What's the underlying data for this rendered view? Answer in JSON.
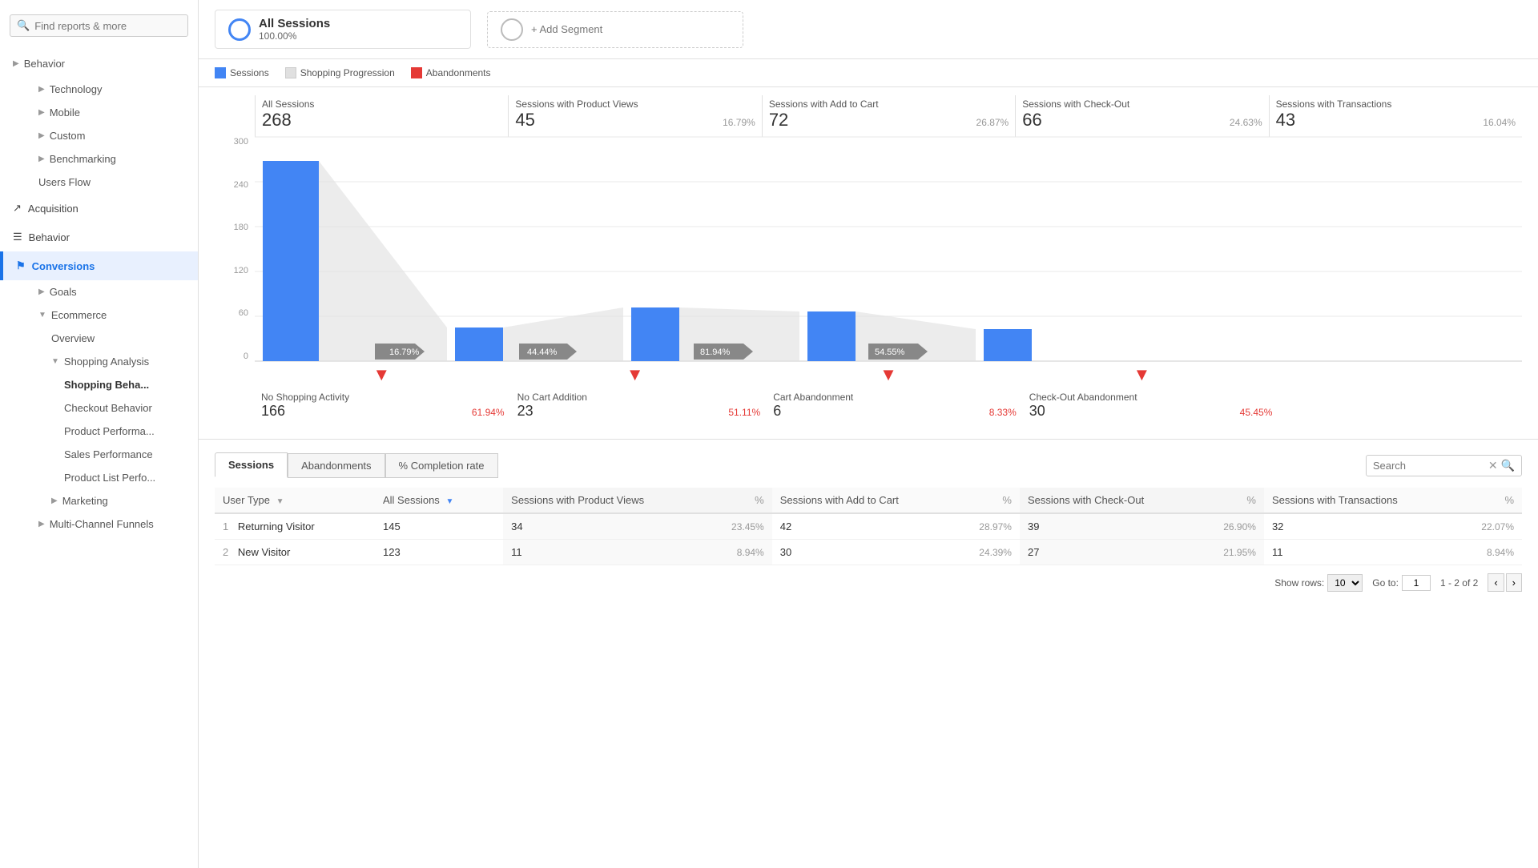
{
  "sidebar": {
    "search_placeholder": "Find reports & more",
    "items": [
      {
        "label": "Behavior",
        "type": "section",
        "arrow": "▶",
        "indent": 0
      },
      {
        "label": "Technology",
        "type": "section",
        "arrow": "▶",
        "indent": 1
      },
      {
        "label": "Mobile",
        "type": "section",
        "arrow": "▶",
        "indent": 1
      },
      {
        "label": "Custom",
        "type": "section",
        "arrow": "▶",
        "indent": 1
      },
      {
        "label": "Benchmarking",
        "type": "section",
        "arrow": "▶",
        "indent": 1
      },
      {
        "label": "Users Flow",
        "type": "item",
        "indent": 1
      },
      {
        "label": "Acquisition",
        "type": "main",
        "icon": "↗"
      },
      {
        "label": "Behavior",
        "type": "main",
        "icon": "☰"
      },
      {
        "label": "Conversions",
        "type": "main-active",
        "icon": "⚑"
      },
      {
        "label": "Goals",
        "type": "sub",
        "arrow": "▶"
      },
      {
        "label": "Ecommerce",
        "type": "sub",
        "arrow": "▼"
      },
      {
        "label": "Overview",
        "type": "sub2"
      },
      {
        "label": "Shopping Analysis",
        "type": "sub2",
        "arrow": "▼"
      },
      {
        "label": "Shopping Beha...",
        "type": "sub3",
        "bold": true
      },
      {
        "label": "Checkout Behavior",
        "type": "sub3"
      },
      {
        "label": "Product Performa...",
        "type": "sub3"
      },
      {
        "label": "Sales Performance",
        "type": "sub3"
      },
      {
        "label": "Product List Perfo...",
        "type": "sub3"
      },
      {
        "label": "Marketing",
        "type": "sub2",
        "arrow": "▶"
      },
      {
        "label": "Multi-Channel Funnels",
        "type": "sub",
        "arrow": "▶"
      }
    ]
  },
  "segment": {
    "name": "All Sessions",
    "pct": "100.00%",
    "add_label": "+ Add Segment"
  },
  "legend": [
    {
      "label": "Sessions",
      "color": "#4285f4",
      "type": "solid"
    },
    {
      "label": "Shopping Progression",
      "color": "#e0e0e0",
      "type": "solid"
    },
    {
      "label": "Abandonments",
      "color": "#e53935",
      "type": "solid"
    }
  ],
  "funnel_stages": [
    {
      "label": "All Sessions",
      "value": "268",
      "pct": ""
    },
    {
      "label": "Sessions with Product Views",
      "value": "45",
      "pct": "16.79%"
    },
    {
      "label": "Sessions with Add to Cart",
      "value": "72",
      "pct": "26.87%"
    },
    {
      "label": "Sessions with Check-Out",
      "value": "66",
      "pct": "24.63%"
    },
    {
      "label": "Sessions with Transactions",
      "value": "43",
      "pct": "16.04%"
    }
  ],
  "funnel_arrows": [
    {
      "pct": "16.79%"
    },
    {
      "pct": "44.44%"
    },
    {
      "pct": "81.94%"
    },
    {
      "pct": "54.55%"
    }
  ],
  "abandonments": [
    {
      "label": "No Shopping Activity",
      "value": "166",
      "pct": "61.94%"
    },
    {
      "label": "No Cart Addition",
      "value": "23",
      "pct": "51.11%"
    },
    {
      "label": "Cart Abandonment",
      "value": "6",
      "pct": "8.33%"
    },
    {
      "label": "Check-Out Abandonment",
      "value": "30",
      "pct": "45.45%"
    }
  ],
  "y_axis": [
    "0",
    "60",
    "120",
    "180",
    "240",
    "300"
  ],
  "table": {
    "tabs": [
      "Sessions",
      "Abandonments",
      "% Completion rate"
    ],
    "active_tab": "Sessions",
    "search_placeholder": "Search",
    "columns": [
      {
        "label": "User Type",
        "sortable": true
      },
      {
        "label": "All Sessions",
        "sortable": true
      },
      {
        "label": "Sessions with Product Views"
      },
      {
        "%": "%"
      },
      {
        "label": "Sessions with Add to Cart"
      },
      {
        "%": "%"
      },
      {
        "label": "Sessions with Check-Out"
      },
      {
        "%": "%"
      },
      {
        "label": "Sessions with Transactions"
      },
      {
        "%": "%"
      }
    ],
    "rows": [
      {
        "num": "1",
        "type": "Returning Visitor",
        "all_sessions": "145",
        "prod_views": "34",
        "prod_pct": "23.45%",
        "add_cart": "42",
        "cart_pct": "28.97%",
        "checkout": "39",
        "checkout_pct": "26.90%",
        "transactions": "32",
        "trans_pct": "22.07%"
      },
      {
        "num": "2",
        "type": "New Visitor",
        "all_sessions": "123",
        "prod_views": "11",
        "prod_pct": "8.94%",
        "add_cart": "30",
        "cart_pct": "24.39%",
        "checkout": "27",
        "checkout_pct": "21.95%",
        "transactions": "11",
        "trans_pct": "8.94%"
      }
    ],
    "show_rows_label": "Show rows:",
    "show_rows_value": "10",
    "goto_label": "Go to:",
    "goto_value": "1",
    "page_info": "1 - 2 of 2"
  },
  "colors": {
    "blue": "#4285f4",
    "red": "#e53935",
    "gray": "#9e9e9e",
    "light_gray": "#e0e0e0",
    "arrow_gray": "#888"
  }
}
